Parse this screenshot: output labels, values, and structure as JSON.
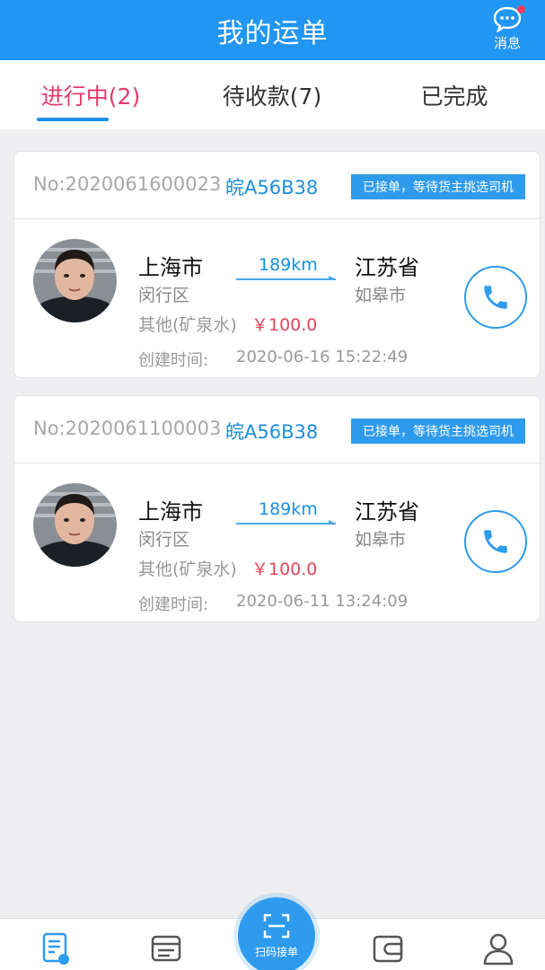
{
  "header": {
    "title": "我的运单",
    "message_label": "消息"
  },
  "tabs": [
    {
      "label": "进行中(2)",
      "active": true
    },
    {
      "label": "待收款(7)",
      "active": false
    },
    {
      "label": "已完成",
      "active": false
    }
  ],
  "orders": [
    {
      "order_no": "No:2020061600023",
      "plate": "皖A56B38",
      "status": "已接单，等待货主挑选司机",
      "from_city": "上海市",
      "from_district": "闵行区",
      "distance": "189km",
      "to_province": "江苏省",
      "to_city": "如皋市",
      "cargo": "其他(矿泉水)",
      "price": "￥100.0",
      "created_label": "创建时间:",
      "created_time": "2020-06-16 15:22:49"
    },
    {
      "order_no": "No:2020061100003",
      "plate": "皖A56B38",
      "status": "已接单，等待货主挑选司机",
      "from_city": "上海市",
      "from_district": "闵行区",
      "distance": "189km",
      "to_province": "江苏省",
      "to_city": "如皋市",
      "cargo": "其他(矿泉水)",
      "price": "￥100.0",
      "created_label": "创建时间:",
      "created_time": "2020-06-11 13:24:09"
    }
  ],
  "bottom_nav": {
    "items": [
      "waybill-icon",
      "list-icon",
      "wallet-icon",
      "user-icon"
    ],
    "scan_label": "扫码接单"
  },
  "colors": {
    "primary": "#2196f3",
    "accent_tab": "#e23b6a",
    "price": "#e4445a",
    "badge": "#2f9bec"
  }
}
